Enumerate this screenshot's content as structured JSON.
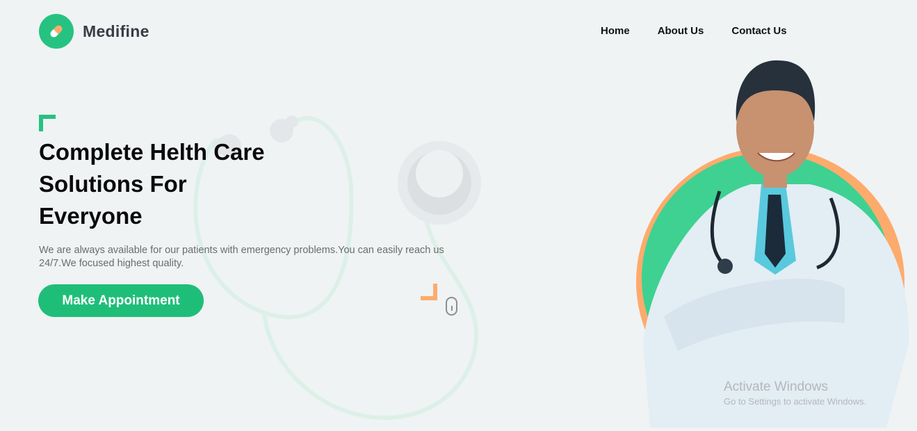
{
  "brand": {
    "name": "Medifine",
    "accent": "#26c281",
    "secondary": "#fdab6c",
    "logo_icon": "pill-icon"
  },
  "nav": {
    "items": [
      "Home",
      "About Us",
      "Contact Us"
    ]
  },
  "hero": {
    "title": "Complete Helth Care Solutions For Everyone",
    "description": "We are always available for our patients with emergency problems.You can easily reach us 24/7.We focused highest quality.",
    "cta_label": "Make Appointment",
    "image": "doctor-photo",
    "scroll_icon": "mouse-scroll-icon"
  },
  "watermark": {
    "title": "Activate Windows",
    "subtitle": "Go to Settings to activate Windows."
  }
}
